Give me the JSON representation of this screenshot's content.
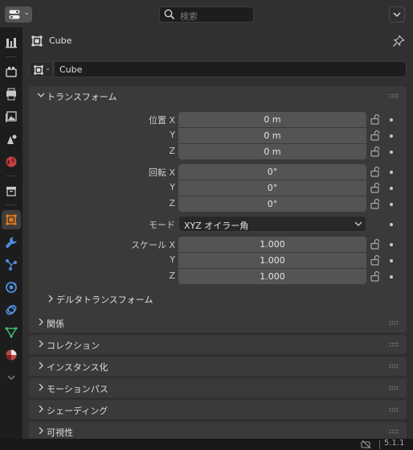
{
  "header": {
    "editor_type_icon": "properties-editor-icon",
    "search_placeholder": "検索"
  },
  "tabs": [
    {
      "name": "tool-tab",
      "icon": "tool-icon",
      "active": false
    },
    {
      "name": "render-tab",
      "icon": "render-icon",
      "active": false
    },
    {
      "name": "output-tab",
      "icon": "printer-icon",
      "active": false
    },
    {
      "name": "view-layer-tab",
      "icon": "image-icon",
      "active": false
    },
    {
      "name": "scene-tab",
      "icon": "scene-icon",
      "active": false
    },
    {
      "name": "world-tab",
      "icon": "world-icon",
      "active": false
    },
    {
      "name": "collection-tab",
      "icon": "collection-box-icon",
      "active": false
    },
    {
      "name": "object-tab",
      "icon": "object-cube-icon",
      "active": true
    },
    {
      "name": "modifier-tab",
      "icon": "wrench-icon",
      "active": false
    },
    {
      "name": "particles-tab",
      "icon": "particles-icon",
      "active": false
    },
    {
      "name": "physics-tab",
      "icon": "physics-icon",
      "active": false
    },
    {
      "name": "constraints-tab",
      "icon": "constraint-icon",
      "active": false
    },
    {
      "name": "data-tab",
      "icon": "mesh-data-icon",
      "active": false
    },
    {
      "name": "material-tab",
      "icon": "material-icon",
      "active": false
    }
  ],
  "object": {
    "title": "Cube",
    "name": "Cube"
  },
  "transform": {
    "title": "トランスフォーム",
    "location": {
      "label_x": "位置 X",
      "label_y": "Y",
      "label_z": "Z",
      "x": "0 m",
      "y": "0 m",
      "z": "0 m"
    },
    "rotation": {
      "label_x": "回転 X",
      "label_y": "Y",
      "label_z": "Z",
      "x": "0°",
      "y": "0°",
      "z": "0°"
    },
    "mode": {
      "label": "モード",
      "value": "XYZ オイラー角"
    },
    "scale": {
      "label_x": "スケール X",
      "label_y": "Y",
      "label_z": "Z",
      "x": "1.000",
      "y": "1.000",
      "z": "1.000"
    },
    "delta_title": "デルタトランスフォーム"
  },
  "panels": [
    {
      "title": "関係"
    },
    {
      "title": "コレクション"
    },
    {
      "title": "インスタンス化"
    },
    {
      "title": "モーションパス"
    },
    {
      "title": "シェーディング"
    },
    {
      "title": "可視性"
    }
  ],
  "status": {
    "version": "5.1.1"
  },
  "colors": {
    "accent_orange": "#e57a1a",
    "active_icon_bg": "#3d3d3d",
    "field_bg": "#545454",
    "panel_bg": "#3a3a3a"
  }
}
